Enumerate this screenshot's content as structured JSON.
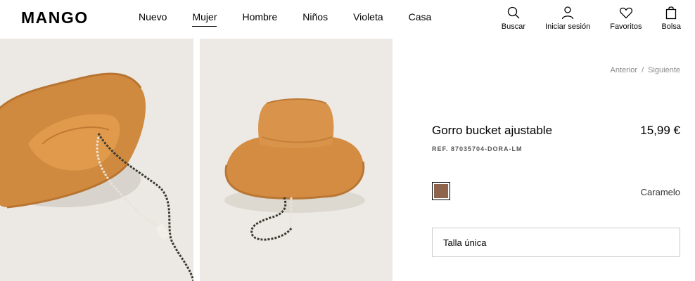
{
  "header": {
    "logo": "MANGO",
    "nav": [
      "Nuevo",
      "Mujer",
      "Hombre",
      "Niños",
      "Violeta",
      "Casa"
    ],
    "active_nav": "Mujer",
    "actions": {
      "search": "Buscar",
      "login": "Iniciar sesión",
      "favorites": "Favoritos",
      "bag": "Bolsa"
    }
  },
  "gallery": {
    "images": [
      {
        "alt": "search-icon-free photo of orange bucket hat lying flat with drawstring"
      },
      {
        "alt": "orange bucket hat standing upright with drawstring"
      }
    ],
    "colors": {
      "background": "#ece8e3",
      "hat": "#d08a3f"
    }
  },
  "product": {
    "pager_prev": "Anterior",
    "pager_sep": "/",
    "pager_next": "Siguiente",
    "title": "Gorro bucket ajustable",
    "price": "15,99 €",
    "ref": "REF. 87035704-DORA-LM",
    "color_name": "Caramelo",
    "swatch_color": "#8f644d",
    "size": "Talla única"
  }
}
